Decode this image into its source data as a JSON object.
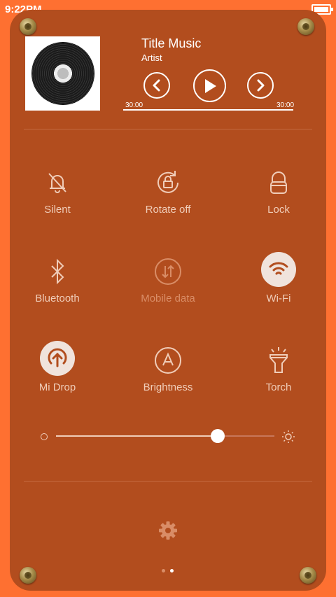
{
  "status_bar": {
    "time": "9:22PM"
  },
  "music": {
    "title": "Title Music",
    "artist": "Artist",
    "time_elapsed": "30:00",
    "time_total": "30:00",
    "progress": 1.0
  },
  "toggles": [
    {
      "label": "Silent",
      "icon": "bell-off-icon",
      "active": false,
      "enabled": true
    },
    {
      "label": "Rotate off",
      "icon": "rotate-lock-icon",
      "active": false,
      "enabled": true
    },
    {
      "label": "Lock",
      "icon": "lock-icon",
      "active": false,
      "enabled": true
    },
    {
      "label": "Bluetooth",
      "icon": "bluetooth-icon",
      "active": false,
      "enabled": true
    },
    {
      "label": "Mobile data",
      "icon": "mobile-data-icon",
      "active": false,
      "enabled": false
    },
    {
      "label": "Wi-Fi",
      "icon": "wifi-icon",
      "active": true,
      "enabled": true
    },
    {
      "label": "Mi Drop",
      "icon": "mi-drop-icon",
      "active": true,
      "enabled": true
    },
    {
      "label": "Brightness",
      "icon": "auto-brightness-icon",
      "active": false,
      "enabled": true
    },
    {
      "label": "Torch",
      "icon": "torch-icon",
      "active": false,
      "enabled": true
    }
  ],
  "brightness": {
    "level": 0.74
  },
  "pager": {
    "count": 2,
    "current": 1
  },
  "colors": {
    "background": "#fe7031",
    "panel": "#b24d1e",
    "label": "#f0cdb9",
    "label_dim": "#d98d67",
    "active_bg": "#f0e3dc"
  }
}
